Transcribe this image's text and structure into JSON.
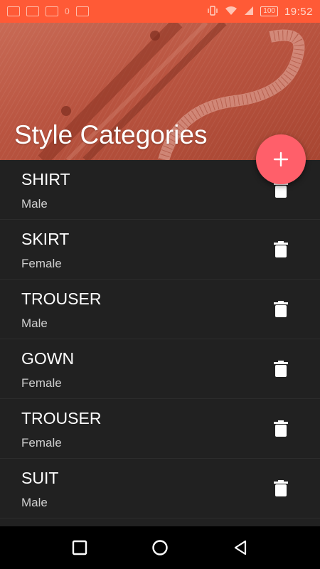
{
  "status_bar": {
    "time": "19:52",
    "battery": "100",
    "left_icons": [
      "notification-icon",
      "gallery-icon",
      "message-icon",
      "zero-indicator",
      "mail-icon"
    ],
    "zero_label": "0",
    "right_icons": [
      "vibrate-icon",
      "wifi-icon",
      "signal-icon",
      "battery-icon"
    ]
  },
  "header": {
    "title": "Style Categories"
  },
  "fab": {
    "icon": "plus-icon",
    "color": "#ff5f6a"
  },
  "categories": [
    {
      "name": "SHIRT",
      "gender": "Male"
    },
    {
      "name": "SKIRT",
      "gender": "Female"
    },
    {
      "name": "TROUSER",
      "gender": "Male"
    },
    {
      "name": "GOWN",
      "gender": "Female"
    },
    {
      "name": "TROUSER",
      "gender": "Female"
    },
    {
      "name": "SUIT",
      "gender": "Male"
    }
  ],
  "nav": {
    "recent": "recent-apps-icon",
    "home": "home-icon",
    "back": "back-icon"
  },
  "colors": {
    "accent": "#ff5a36",
    "fab": "#ff5f6a",
    "list_bg": "#212121"
  }
}
